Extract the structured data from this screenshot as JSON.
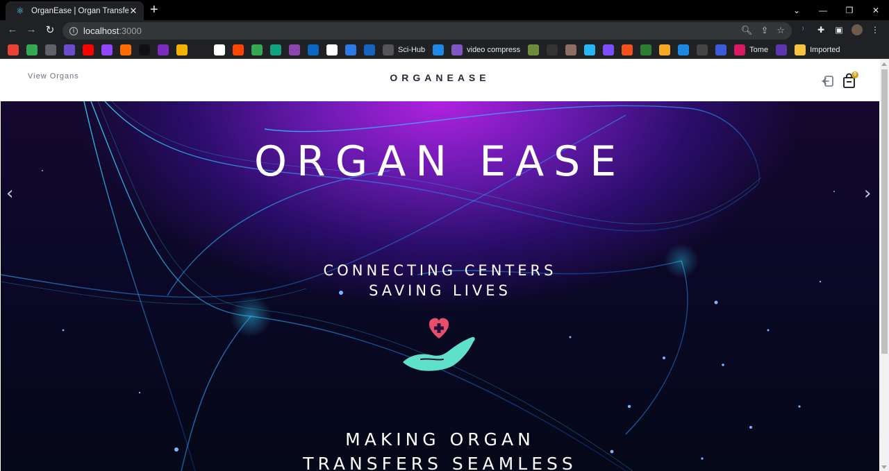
{
  "browser": {
    "tab_title": "OrganEase | Organ Transfer",
    "new_tab": "+",
    "url_host": "localhost",
    "url_port": ":3000",
    "bookmarks": [
      {
        "icon": "gmail-icon",
        "label": ""
      },
      {
        "icon": "maps-icon",
        "label": ""
      },
      {
        "icon": "globe-icon",
        "label": ""
      },
      {
        "icon": "vclp-icon",
        "label": ""
      },
      {
        "icon": "youtube-icon",
        "label": ""
      },
      {
        "icon": "twitch-icon",
        "label": ""
      },
      {
        "icon": "play-icon",
        "label": ""
      },
      {
        "icon": "x-icon",
        "label": ""
      },
      {
        "icon": "video-icon",
        "label": ""
      },
      {
        "icon": "m-icon",
        "label": ""
      },
      {
        "icon": "bolt-icon",
        "label": ""
      },
      {
        "icon": "film-icon",
        "label": ""
      },
      {
        "icon": "reddit-icon",
        "label": ""
      },
      {
        "icon": "image-icon",
        "label": ""
      },
      {
        "icon": "chatgpt-icon",
        "label": ""
      },
      {
        "icon": "u-icon",
        "label": ""
      },
      {
        "icon": "linkedin-icon",
        "label": ""
      },
      {
        "icon": "github-icon",
        "label": ""
      },
      {
        "icon": "c-icon",
        "label": ""
      },
      {
        "icon": "c2-icon",
        "label": ""
      },
      {
        "icon": "scihub-icon",
        "label": "Sci-Hub"
      },
      {
        "icon": "link-icon",
        "label": ""
      },
      {
        "icon": "compress-icon",
        "label": "video compress"
      },
      {
        "icon": "box-icon",
        "label": ""
      },
      {
        "icon": "dark-icon",
        "label": ""
      },
      {
        "icon": "photo-icon",
        "label": ""
      },
      {
        "icon": "infinity-icon",
        "label": ""
      },
      {
        "icon": "wave-icon",
        "label": ""
      },
      {
        "icon": "cross-icon",
        "label": ""
      },
      {
        "icon": "leaf-icon",
        "label": ""
      },
      {
        "icon": "puzzle-icon",
        "label": ""
      },
      {
        "icon": "s-icon",
        "label": ""
      },
      {
        "icon": "un-icon",
        "label": ""
      },
      {
        "icon": "d-icon",
        "label": ""
      },
      {
        "icon": "tome-icon",
        "label": "Tome"
      },
      {
        "icon": "g-icon",
        "label": ""
      },
      {
        "icon": "folder-icon",
        "label": "Imported"
      }
    ]
  },
  "header": {
    "nav_link": "View Organs",
    "brand": "ORGANEASE",
    "cart_count": "0"
  },
  "hero": {
    "title": "ORGAN EASE",
    "tagline_1a": "CONNECTING CENTERS",
    "tagline_1b": "SAVING LIVES",
    "tagline_2a": "MAKING ORGAN",
    "tagline_2b": "TRANSFERS SEAMLESS",
    "prev_arrow": "‹",
    "next_arrow": "›"
  },
  "colors": {
    "accent_heart": "#e84d6a",
    "accent_hand": "#5fe0c8",
    "badge": "#d4a017"
  }
}
